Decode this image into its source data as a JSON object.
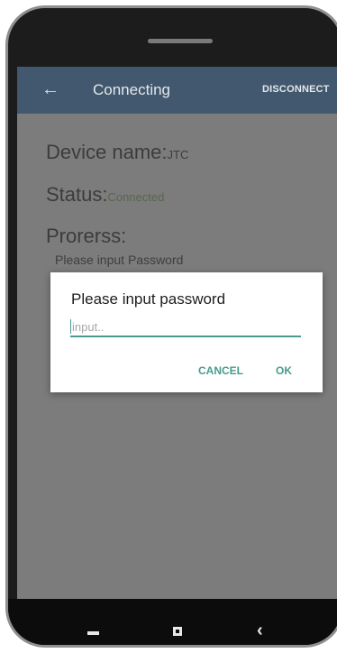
{
  "appbar": {
    "back_icon": "back-arrow-icon",
    "title": "Connecting",
    "disconnect_label": "DISCONNECT"
  },
  "info": {
    "device_label": "Device name:",
    "device_value": "JTC",
    "status_label": "Status:",
    "status_value": "Connected",
    "progress_label": "Prorerss:",
    "progress_message": "Please input Password"
  },
  "dialog": {
    "title": "Please input password",
    "input_placeholder": "input..",
    "input_value": "",
    "cancel_label": "CANCEL",
    "ok_label": "OK"
  },
  "navbar": {
    "icons": [
      "menu-bar-icon",
      "home-square-icon",
      "back-chevron-icon"
    ],
    "back_glyph": "‹"
  },
  "colors": {
    "appbar": "#42586e",
    "accent": "#4a9b8e",
    "scrim": "#7c7c7c"
  }
}
